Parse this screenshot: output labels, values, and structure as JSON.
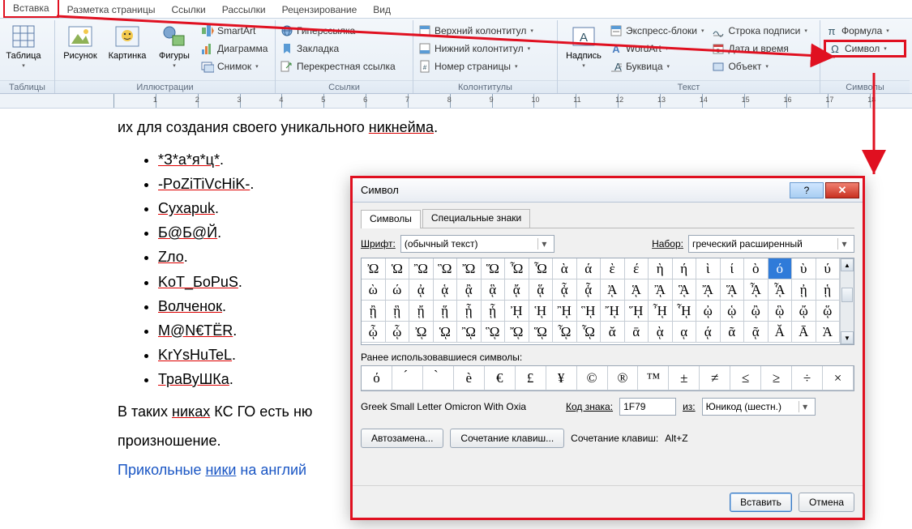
{
  "tabs": {
    "insert": "Вставка",
    "layout": "Разметка страницы",
    "references": "Ссылки",
    "mailings": "Рассылки",
    "review": "Рецензирование",
    "view": "Вид"
  },
  "ribbon": {
    "tables_group": "Таблицы",
    "table": "Таблица",
    "illustrations_group": "Иллюстрации",
    "picture": "Рисунок",
    "clipart": "Картинка",
    "shapes": "Фигуры",
    "smartart": "SmartArt",
    "chart": "Диаграмма",
    "screenshot": "Снимок",
    "links_group": "Ссылки",
    "hyperlink": "Гиперссылка",
    "bookmark": "Закладка",
    "crossref": "Перекрестная ссылка",
    "header_footer_group": "Колонтитулы",
    "header": "Верхний колонтитул",
    "footer": "Нижний колонтитул",
    "page_number": "Номер страницы",
    "textbox": "Надпись",
    "text_group": "Текст",
    "quickparts": "Экспресс-блоки",
    "wordart": "WordArt",
    "dropcap": "Буквица",
    "sigline": "Строка подписи",
    "datetime": "Дата и время",
    "object": "Объект",
    "symbols_group": "Символы",
    "equation": "Формула",
    "symbol": "Символ"
  },
  "document": {
    "top_line_pre": "их для создания своего уникального ",
    "top_line_uline": "никнейма",
    "bullets": [
      "*З*а*я*ц*.",
      "-PoZiTiVcHiK-.",
      "Cyxapuk.",
      "Б@Б@Й.",
      "Zло.",
      "KoT_БoPuS.",
      "Волченок.",
      "M@N€TËR.",
      "KrYsHuTeL.",
      "ТраВуШКа."
    ],
    "para2_a": "В таких ",
    "para2_b": "никах",
    "para2_c": " КС ГО есть ню",
    "para3": "произношение.",
    "bluelink_a": "Прикольные ",
    "bluelink_b": "ники",
    "bluelink_c": " на англий"
  },
  "dialog": {
    "title": "Символ",
    "tab_symbols": "Символы",
    "tab_special": "Специальные знаки",
    "font_label": "Шрифт:",
    "font_value": "(обычный текст)",
    "set_label": "Набор:",
    "set_value": "греческий расширенный",
    "grid": [
      [
        "Ὠ",
        "Ὡ",
        "Ὢ",
        "Ὣ",
        "Ὤ",
        "Ὥ",
        "Ὦ",
        "Ὧ",
        "ὰ",
        "ά",
        "ὲ",
        "έ",
        "ὴ",
        "ή",
        "ὶ",
        "ί",
        "ὸ",
        "ό",
        "ὺ",
        "ύ"
      ],
      [
        "ὼ",
        "ώ",
        "ᾀ",
        "ᾁ",
        "ᾂ",
        "ᾃ",
        "ᾄ",
        "ᾅ",
        "ᾆ",
        "ᾇ",
        "ᾈ",
        "ᾉ",
        "ᾊ",
        "ᾋ",
        "ᾌ",
        "ᾍ",
        "ᾎ",
        "ᾏ",
        "ᾐ",
        "ᾑ"
      ],
      [
        "ᾒ",
        "ᾓ",
        "ᾔ",
        "ᾕ",
        "ᾖ",
        "ᾗ",
        "ᾘ",
        "ᾙ",
        "ᾚ",
        "ᾛ",
        "ᾜ",
        "ᾝ",
        "ᾞ",
        "ᾟ",
        "ᾠ",
        "ᾡ",
        "ᾢ",
        "ᾣ",
        "ᾤ",
        "ᾥ"
      ],
      [
        "ᾦ",
        "ᾧ",
        "ᾨ",
        "ᾩ",
        "ᾪ",
        "ᾫ",
        "ᾬ",
        "ᾭ",
        "ᾮ",
        "ᾯ",
        "ᾰ",
        "ᾱ",
        "ᾲ",
        "ᾳ",
        "ᾴ",
        "ᾶ",
        "ᾷ",
        "Ᾰ",
        "Ᾱ",
        "Ὰ"
      ]
    ],
    "selected_row": 0,
    "selected_col": 17,
    "recent_label": "Ранее использовавшиеся символы:",
    "recent": [
      "ό",
      " ́",
      " ̀",
      "ѐ",
      "€",
      "£",
      "¥",
      "©",
      "®",
      "™",
      "±",
      "≠",
      "≤",
      "≥",
      "÷",
      "×"
    ],
    "char_name": "Greek Small Letter Omicron With Oxia",
    "code_label": "Код знака:",
    "code_value": "1F79",
    "from_label": "из:",
    "from_value": "Юникод (шестн.)",
    "autocorrect": "Автозамена...",
    "shortcutkey": "Сочетание клавиш...",
    "shortcut_label": "Сочетание клавиш:",
    "shortcut_value": "Alt+Z",
    "insert": "Вставить",
    "cancel": "Отмена"
  }
}
